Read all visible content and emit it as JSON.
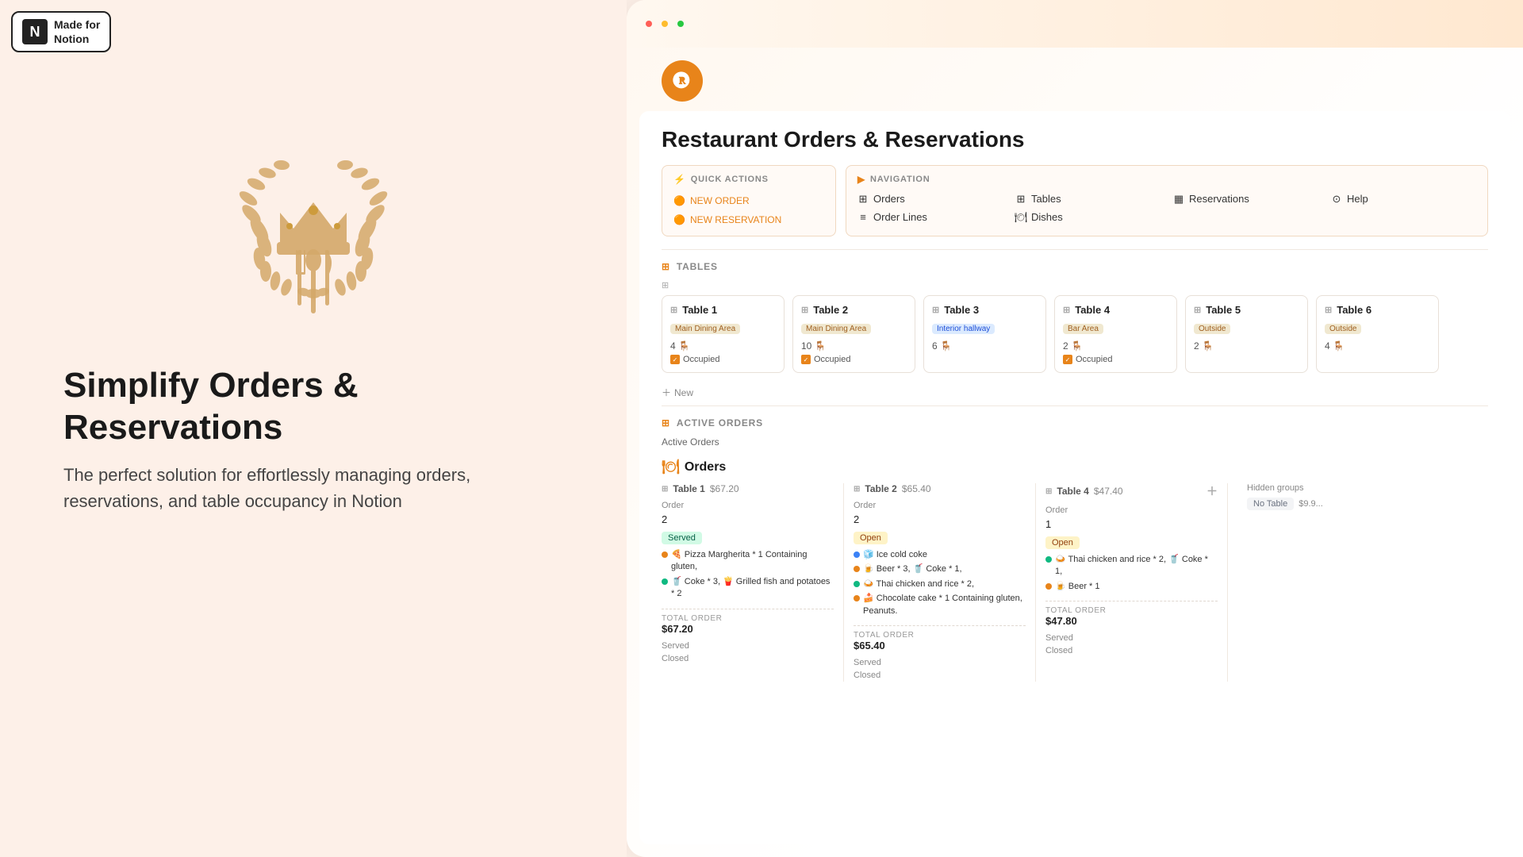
{
  "left": {
    "badge": {
      "icon": "N",
      "line1": "Made for",
      "line2": "Notion"
    },
    "hero_title": "Simplify Orders & Reservations",
    "hero_subtitle": "The perfect solution for effortlessly managing orders, reservations, and table occupancy in Notion"
  },
  "right": {
    "page_title": "Restaurant Orders & Reservations",
    "quick_actions": {
      "header": "QUICK ACTIONS",
      "buttons": [
        {
          "label": "NEW ORDER"
        },
        {
          "label": "NEW RESERVATION"
        }
      ]
    },
    "navigation": {
      "header": "NAVIGATION",
      "items": [
        {
          "label": "Orders",
          "icon": "grid"
        },
        {
          "label": "Tables",
          "icon": "grid"
        },
        {
          "label": "Reservations",
          "icon": "table"
        },
        {
          "label": "Help",
          "icon": "circle-q"
        },
        {
          "label": "Order Lines",
          "icon": "list"
        },
        {
          "label": "Dishes",
          "icon": "dish"
        }
      ]
    },
    "tables_section": {
      "header": "TABLES",
      "tables": [
        {
          "name": "Table 1",
          "area": "Main Dining Area",
          "area_color": "orange",
          "seats": "4 🪑",
          "occupied": true
        },
        {
          "name": "Table 2",
          "area": "Main Dining Area",
          "area_color": "orange",
          "seats": "10 🪑",
          "occupied": true
        },
        {
          "name": "Table 3",
          "area": "Interior hallway",
          "area_color": "blue",
          "seats": "6 🪑",
          "occupied": false
        },
        {
          "name": "Table 4",
          "area": "Bar Area",
          "area_color": "orange",
          "seats": "2 🪑",
          "occupied": true
        },
        {
          "name": "Table 5",
          "area": "Outside",
          "area_color": "orange",
          "seats": "2 🪑",
          "occupied": false
        },
        {
          "name": "Table 6",
          "area": "Outside",
          "area_color": "orange",
          "seats": "4 🪑",
          "occupied": false
        }
      ],
      "add_label": "New"
    },
    "active_orders": {
      "header": "ACTIVE ORDERS",
      "section_label": "Active Orders",
      "title": "Orders",
      "columns": [
        {
          "table": "Table 1",
          "price": "$67.20",
          "order_num": "2",
          "status": "Served",
          "status_type": "served",
          "items": [
            "🍕 Pizza Margherita * 1 Containing gluten,",
            "🥤 Coke * 3,  🍟 Grilled fish and potatoes * 2"
          ],
          "total_label": "TOTAL ORDER",
          "total": "$67.20",
          "status_rows": [
            "Served",
            "Closed"
          ]
        },
        {
          "table": "Table 2",
          "price": "$65.40",
          "order_num": "2",
          "status": "Open",
          "status_type": "open",
          "items": [
            "🧊 Ice cold coke",
            "🍺 Beer * 3,  🥤 Coke * 1,",
            "🍛 Thai chicken and rice * 2,",
            "🍰 Chocolate cake * 1 Containing gluten, Peanuts."
          ],
          "total_label": "TOTAL ORDER",
          "total": "$65.40",
          "status_rows": [
            "Served",
            "Closed"
          ]
        },
        {
          "table": "Table 4",
          "price": "$47.40",
          "order_num": "1",
          "status": "Open",
          "status_type": "open",
          "items": [
            "🍛 Thai chicken and rice * 2,  🥤 Coke * 1,",
            "🍺 Beer * 1"
          ],
          "total_label": "TOTAL ORDER",
          "total": "$47.80",
          "status_rows": [
            "Served",
            "Closed"
          ]
        }
      ],
      "hidden_groups": {
        "label": "Hidden groups",
        "no_table": "No Table",
        "no_table_price": "$9.9..."
      }
    }
  }
}
